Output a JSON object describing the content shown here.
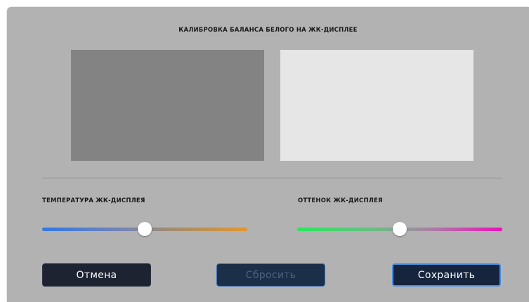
{
  "dialog": {
    "title": "КАЛИБРОВКА БАЛАНСА БЕЛОГО НА ЖК-ДИСПЛЕЕ",
    "preview": {
      "left_color": "#838383",
      "right_color": "#e6e6e6"
    },
    "temperature": {
      "label": "ТЕМПЕРАТУРА ЖК-ДИСПЛЕЯ",
      "value_fraction": 0.5,
      "gradient": [
        "#2f78e8",
        "#e3962c"
      ]
    },
    "tint": {
      "label": "ОТТЕНОК ЖК-ДИСПЛЕЯ",
      "value_fraction": 0.5,
      "gradient": [
        "#27e85e",
        "#ee10b8"
      ]
    },
    "buttons": {
      "cancel": "Отмена",
      "reset": "Сбросить",
      "save": "Сохранить"
    },
    "reset_disabled": true
  }
}
